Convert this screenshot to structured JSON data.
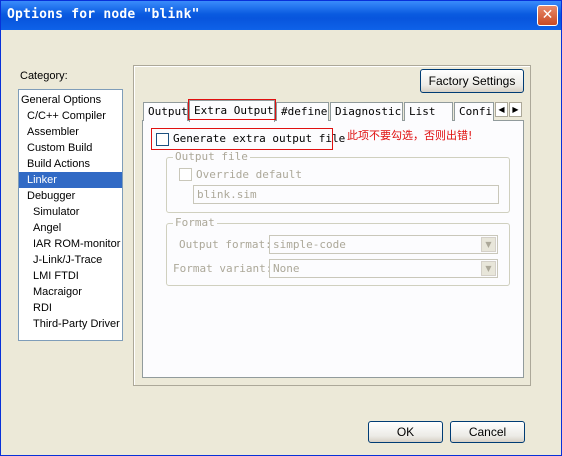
{
  "window": {
    "title": "Options for node \"blink\""
  },
  "titlebar": {
    "close_icon": "close-icon",
    "close_glyph": "✕"
  },
  "category": {
    "label": "Category:",
    "items": [
      {
        "label": "General Options"
      },
      {
        "label": "C/C++ Compiler"
      },
      {
        "label": "Assembler"
      },
      {
        "label": "Custom Build"
      },
      {
        "label": "Build Actions"
      },
      {
        "label": "Linker",
        "selected": true
      },
      {
        "label": "Debugger"
      },
      {
        "label": "Simulator"
      },
      {
        "label": "Angel"
      },
      {
        "label": "IAR ROM-monitor"
      },
      {
        "label": "J-Link/J-Trace"
      },
      {
        "label": "LMI FTDI"
      },
      {
        "label": "Macraigor"
      },
      {
        "label": "RDI"
      },
      {
        "label": "Third-Party Driver"
      }
    ]
  },
  "factory_settings": "Factory Settings",
  "tabs": [
    {
      "label": "Output"
    },
    {
      "label": "Extra Output",
      "active": true
    },
    {
      "label": "#define"
    },
    {
      "label": "Diagnostics"
    },
    {
      "label": "List"
    },
    {
      "label": "Confi"
    }
  ],
  "tab_scroll": {
    "left": "◀",
    "right": "▶"
  },
  "extra_output": {
    "generate_label": "Generate extra output file",
    "generate_checked": false,
    "annotation": "此项不要勾选，否则出错!",
    "output_file": {
      "group_label": "Output file",
      "override_label": "Override default",
      "filename": "blink.sim"
    },
    "format": {
      "group_label": "Format",
      "output_format_label": "Output format:",
      "output_format_value": "simple-code",
      "format_variant_label": "Format variant:",
      "format_variant_value": "None"
    }
  },
  "footer": {
    "ok": "OK",
    "cancel": "Cancel"
  },
  "colors": {
    "annotation": "#E01010",
    "selection": "#316AC5",
    "titlebar": "#0A5BE0"
  }
}
